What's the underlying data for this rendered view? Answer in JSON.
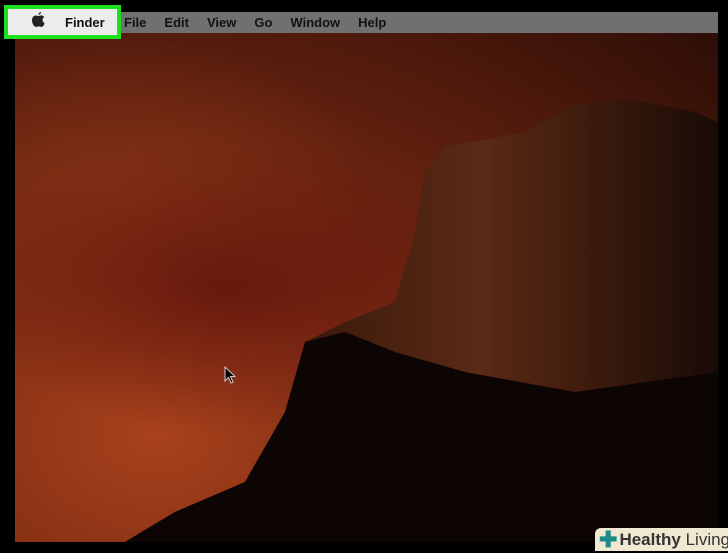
{
  "menubar": {
    "apple_icon": "apple-icon",
    "items": [
      "Finder",
      "File",
      "Edit",
      "View",
      "Go",
      "Window",
      "Help"
    ]
  },
  "highlight_color": "#1fe01f",
  "watermark": {
    "bold": "Healthy",
    "rest": " Living"
  }
}
